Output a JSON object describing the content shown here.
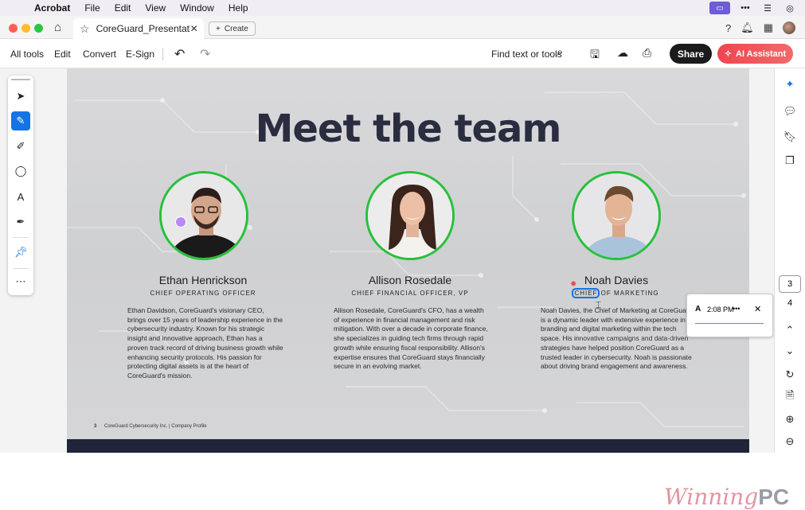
{
  "menubar": {
    "app": "Acrobat",
    "items": [
      "File",
      "Edit",
      "View",
      "Window",
      "Help"
    ]
  },
  "tabbar": {
    "tab_title": "CoreGuard_Presentati...",
    "create_label": "Create"
  },
  "toolbar": {
    "items": [
      "All tools",
      "Edit",
      "Convert",
      "E-Sign"
    ],
    "find_label": "Find text or tools",
    "share_label": "Share",
    "ai_label": "AI Assistant"
  },
  "slide": {
    "title": "Meet the team",
    "people": [
      {
        "name": "Ethan Henrickson",
        "role": "CHIEF OPERATING OFFICER",
        "bio": "Ethan Davidson, CoreGuard's visionary CEO, brings over 15 years of leadership experience in the cybersecurity industry. Known for his strategic insight and innovative approach, Ethan has a proven track record of driving business growth while enhancing security protocols. His passion for protecting digital assets is at the heart of CoreGuard's mission."
      },
      {
        "name": "Allison Rosedale",
        "role": "CHIEF FINANCIAL OFFICER, VP",
        "bio": "Allison Rosedale, CoreGuard's CFO, has a wealth of experience in financial management and risk mitigation. With over a decade in corporate finance, she specializes in guiding tech firms through rapid growth while ensuring fiscal responsibility. Allison's expertise ensures that CoreGuard stays financially secure in an evolving market."
      },
      {
        "name": "Noah Davies",
        "role_highlight": "CHIEF",
        "role": "OF MARKETING",
        "bio": "Noah Davies, the Chief of Marketing at CoreGuard, is a dynamic leader with extensive experience in branding and digital marketing within the tech space. His innovative campaigns and data-driven strategies have helped position CoreGuard as a trusted leader in cybersecurity. Noah is passionate about driving brand engagement and awareness."
      }
    ],
    "footer_page": "3",
    "footer_text": "CoreGuard  Cybersecurity Inc. | Company Profile"
  },
  "comment": {
    "author_initial": "A",
    "time": "2:08 PM",
    "more": "•••",
    "close": "✕"
  },
  "pagenav": {
    "current": "3",
    "total": "4"
  },
  "watermark": {
    "text1": "Winning",
    "text2": "PC"
  }
}
